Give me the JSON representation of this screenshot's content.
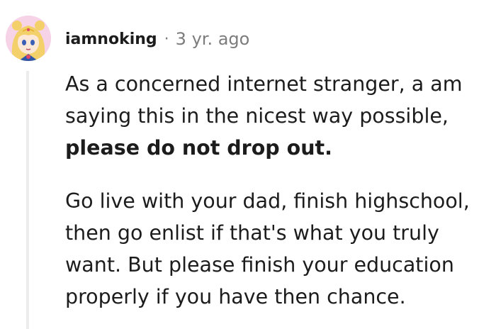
{
  "comment": {
    "author": "iamnoking",
    "separator": "·",
    "timestamp": "3 yr. ago",
    "paragraphs": [
      {
        "lines": [
          "As a concerned internet stranger, a am",
          "saying this in the nicest way possible,"
        ],
        "bold_line": "please do not drop out."
      },
      {
        "lines": [
          "Go live with your dad, finish highschool,",
          "then go enlist if that's what you truly",
          "want. But please finish your education",
          "properly if you have then chance."
        ]
      }
    ]
  },
  "colors": {
    "text": "#1c1c1c",
    "meta": "#7c7c7c",
    "thread_line": "#ececec",
    "avatar_bg": "#f6d3e6"
  }
}
